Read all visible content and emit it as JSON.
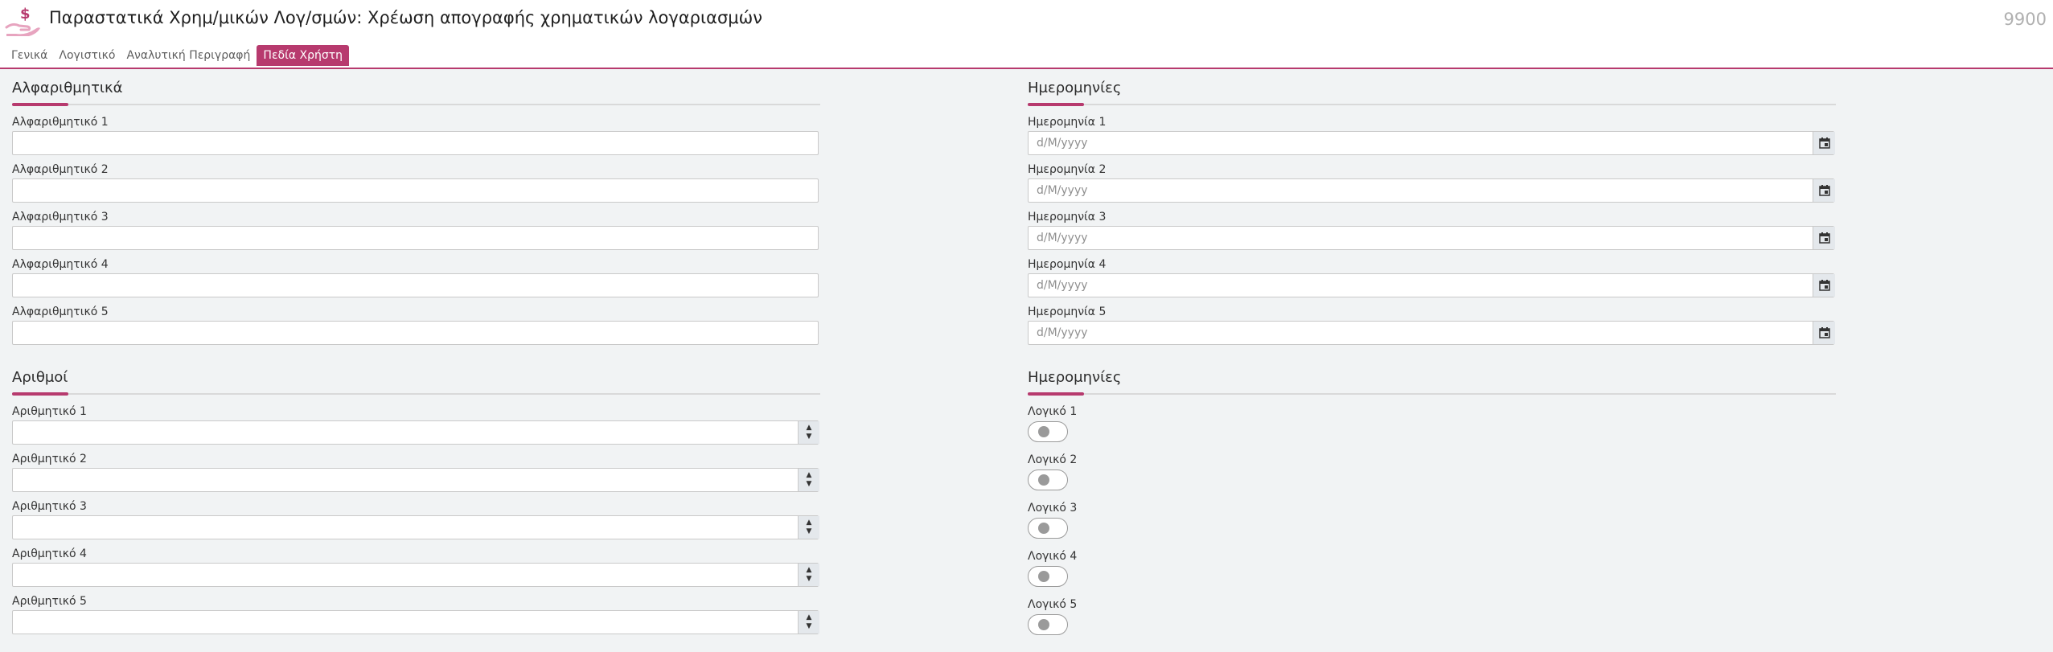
{
  "header": {
    "title": "Παραστατικά Χρημ/μικών Λογ/σμών: Χρέωση απογραφής χρηματικών λογαριασμών",
    "code": "9900",
    "icon": "money-hand-icon"
  },
  "tabs": [
    {
      "label": "Γενικά",
      "active": false
    },
    {
      "label": "Λογιστικό",
      "active": false
    },
    {
      "label": "Αναλυτική Περιγραφή",
      "active": false
    },
    {
      "label": "Πεδία Χρήστη",
      "active": true
    }
  ],
  "colors": {
    "accent": "#b73a6e",
    "background": "#f1f3f4"
  },
  "alpha": {
    "title": "Αλφαριθμητικά",
    "fields": [
      {
        "label": "Αλφαριθμητικό 1",
        "value": ""
      },
      {
        "label": "Αλφαριθμητικό 2",
        "value": ""
      },
      {
        "label": "Αλφαριθμητικό 3",
        "value": ""
      },
      {
        "label": "Αλφαριθμητικό 4",
        "value": ""
      },
      {
        "label": "Αλφαριθμητικό 5",
        "value": ""
      }
    ]
  },
  "numbers": {
    "title": "Αριθμοί",
    "fields": [
      {
        "label": "Αριθμητικό 1",
        "value": ""
      },
      {
        "label": "Αριθμητικό 2",
        "value": ""
      },
      {
        "label": "Αριθμητικό 3",
        "value": ""
      },
      {
        "label": "Αριθμητικό 4",
        "value": ""
      },
      {
        "label": "Αριθμητικό 5",
        "value": ""
      }
    ]
  },
  "dates": {
    "title": "Ημερομηνίες",
    "placeholder": "d/M/yyyy",
    "fields": [
      {
        "label": "Ημερομηνία 1",
        "value": ""
      },
      {
        "label": "Ημερομηνία 2",
        "value": ""
      },
      {
        "label": "Ημερομηνία 3",
        "value": ""
      },
      {
        "label": "Ημερομηνία 4",
        "value": ""
      },
      {
        "label": "Ημερομηνία 5",
        "value": ""
      }
    ]
  },
  "booleans": {
    "title": "Ημερομηνίες",
    "fields": [
      {
        "label": "Λογικό 1",
        "checked": false
      },
      {
        "label": "Λογικό 2",
        "checked": false
      },
      {
        "label": "Λογικό 3",
        "checked": false
      },
      {
        "label": "Λογικό 4",
        "checked": false
      },
      {
        "label": "Λογικό 5",
        "checked": false
      }
    ]
  }
}
